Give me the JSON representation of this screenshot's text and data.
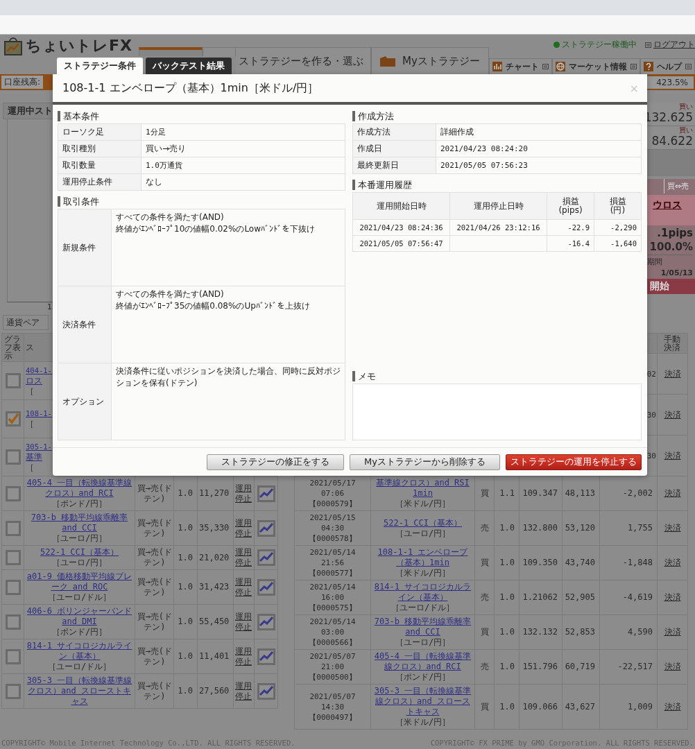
{
  "header": {
    "logo": "ちょいトレFX",
    "nav_tabs": [
      {
        "selected": true
      },
      {
        "label": "ストラテジーを作る・選ぶ",
        "selected": false
      },
      {
        "label": "Myストラテジー",
        "selected": false
      }
    ],
    "status": "ストラテジー稼働中",
    "logout": "ログアウト",
    "tools": [
      {
        "label": "チャート",
        "kind": "chart"
      },
      {
        "label": "マーケット情報",
        "kind": "globe"
      },
      {
        "label": "ヘルプ",
        "kind": "help"
      }
    ],
    "balance_label": "口座残高:",
    "ratio": "423.5%"
  },
  "left_panel": {
    "title": "運用中スト",
    "axis_label": "1",
    "currency_label": "通貨ペア"
  },
  "side_panel": {
    "rates": [
      {
        "label": "買い",
        "value": "132.625"
      },
      {
        "label": "買い",
        "value": "84.622"
      }
    ],
    "card": {
      "header": "買⇔売",
      "link": "ウロス",
      "pips": ".1pips",
      "ratio": "100.0%",
      "period_label": "期間",
      "period": "1/05/13",
      "button": "開始"
    }
  },
  "left_table": {
    "columns": [
      "グラフ表示",
      "ス"
    ],
    "rows": [
      {
        "kind": "partial",
        "checked": false,
        "fragments": [
          "404-1-",
          "ロス",
          "［"
        ]
      },
      {
        "kind": "partial",
        "checked": true,
        "fragments": [
          "108-1-",
          "［"
        ]
      },
      {
        "kind": "partial",
        "checked": false,
        "fragments": [
          "305-1-",
          "基準",
          "［"
        ]
      },
      {
        "kind": "full",
        "checked": false,
        "name": "405-4 一目（転換線基準線クロス）and RCI",
        "pair": "［ポンド/円］",
        "type": "買→売(ドテン)",
        "qty": "1.0",
        "amount": "11,270",
        "stop": "運用停止"
      },
      {
        "kind": "full",
        "checked": false,
        "name": "703-b 移動平均線乖離率 and CCI",
        "pair": "［ユーロ/円］",
        "type": "買→売(ドテン)",
        "qty": "1.0",
        "amount": "35,330",
        "stop": "運用停止"
      },
      {
        "kind": "full",
        "checked": false,
        "name": "522-1 CCI（基本）",
        "pair": "［ユーロ/円］",
        "type": "買→売(ドテン)",
        "qty": "1.0",
        "amount": "21,020",
        "stop": "運用停止"
      },
      {
        "kind": "full",
        "checked": false,
        "name": "a01-9 価格移動平均線ブレーク and ROC",
        "pair": "［ユーロ/ドル］",
        "type": "買→売(ドテン)",
        "qty": "1.0",
        "amount": "31,423",
        "stop": "運用停止"
      },
      {
        "kind": "full",
        "checked": false,
        "name": "406-6 ボリンジャーバンド and DMI",
        "pair": "［ポンド/円］",
        "type": "買→売(ドテン)",
        "qty": "1.0",
        "amount": "55,450",
        "stop": "運用停止"
      },
      {
        "kind": "full",
        "checked": false,
        "name": "814-1 サイコロジカルライン（基本）",
        "pair": "［ユーロ/ドル］",
        "type": "買→売(ドテン)",
        "qty": "1.0",
        "amount": "11,401",
        "stop": "運用停止"
      },
      {
        "kind": "full",
        "checked": false,
        "name": "305-3 一目（転換線基準線クロス）and スローストキャス",
        "type": "買→売(ドテン)",
        "qty": "1.0",
        "amount": "27,560",
        "stop": "運用停止"
      }
    ]
  },
  "right_table": {
    "columns": [
      "手動決済"
    ],
    "rows": [
      {
        "kind": "partial",
        "pnl": "02",
        "settle": "決済"
      },
      {
        "kind": "partial",
        "pnl": "30",
        "settle": "決済"
      },
      {
        "kind": "partial",
        "pnl": "30",
        "settle": "決済"
      },
      {
        "kind": "full",
        "date": "2021/05/17 07:06",
        "id": "【0000579】",
        "name": "基準線クロス）and RSI 1min",
        "pair": "［米ドル/円］",
        "side": "買",
        "qty": "1.1",
        "price": "109.347",
        "amount": "48,113",
        "pnl": "-2,002",
        "settle": "決済"
      },
      {
        "kind": "full",
        "date": "2021/05/15 04:30",
        "id": "【0000578】",
        "name": "522-1 CCI（基本）",
        "pair": "［ユーロ/円］",
        "side": "売",
        "qty": "1.0",
        "price": "132.800",
        "amount": "53,120",
        "pnl": "1,755",
        "settle": "決済"
      },
      {
        "kind": "full",
        "date": "2021/05/14 21:56",
        "id": "【0000577】",
        "name": "108-1-1 エンベロープ（基本）1min",
        "pair": "［米ドル/円］",
        "side": "買",
        "qty": "1.0",
        "price": "109.350",
        "amount": "43,740",
        "pnl": "-1,848",
        "settle": "決済"
      },
      {
        "kind": "full",
        "date": "2021/05/14 16:00",
        "id": "【0000575】",
        "name": "814-1 サイコロジカルライン（基本）",
        "pair": "［ユーロ/ドル］",
        "side": "売",
        "qty": "1.0",
        "price": "1.21062",
        "amount": "52,905",
        "pnl": "-4,619",
        "settle": "決済"
      },
      {
        "kind": "full",
        "date": "2021/05/14 03:00",
        "id": "【0000566】",
        "name": "703-b 移動平均線乖離率 and CCI",
        "pair": "［ユーロ/円］",
        "side": "買",
        "qty": "1.0",
        "price": "132.132",
        "amount": "52,853",
        "pnl": "4,590",
        "settle": "決済"
      },
      {
        "kind": "full",
        "date": "2021/05/07 21:00",
        "id": "【0000500】",
        "name": "405-4 一目（転換線基準線クロス）and RCI",
        "pair": "［ポンド/円］",
        "side": "売",
        "qty": "1.0",
        "price": "151.796",
        "amount": "60,719",
        "pnl": "-22,517",
        "settle": "決済"
      },
      {
        "kind": "full",
        "date": "2021/05/07 14:30",
        "id": "【0000497】",
        "name": "305-3 一目（転換線基準線クロス）and スローストキャス",
        "pair": "［米ドル/円］",
        "side": "買",
        "qty": "1.0",
        "price": "109.066",
        "amount": "43,627",
        "pnl": "1,009",
        "settle": "決済"
      }
    ]
  },
  "footer": {
    "left": "COPYRIGHT© Mobile Internet Technology Co.,LTD. ALL RIGHTS RESERVED.",
    "right": "COPYRIGHT© FX PRIME by GMO Corporation. ALL RIGHTS RESERVED."
  },
  "modal": {
    "tabs": [
      {
        "label": "ストラテジー条件",
        "selected": true
      },
      {
        "label": "バックテスト結果",
        "selected": false
      }
    ],
    "title": "108-1-1 エンベロープ（基本）1min［米ドル/円］",
    "close": "×",
    "basic": {
      "heading": "基本条件",
      "rows": [
        [
          "ローソク足",
          "1分足"
        ],
        [
          "取引種別",
          "買い→売り"
        ],
        [
          "取引数量",
          "1.0万通貨"
        ],
        [
          "運用停止条件",
          "なし"
        ]
      ]
    },
    "trade": {
      "heading": "取引条件",
      "rows": [
        {
          "label": "新規条件",
          "lines": [
            "すべての条件を満たす(AND)",
            "終値がｴﾝﾍﾞﾛｰﾌﾟ10の値幅0.02%のLowﾊﾞﾝﾄﾞを下抜け"
          ]
        },
        {
          "label": "決済条件",
          "lines": [
            "すべての条件を満たす(AND)",
            "終値がｴﾝﾍﾞﾛｰﾌﾟ35の値幅0.08%のUpﾊﾞﾝﾄﾞを上抜け"
          ]
        },
        {
          "label": "オプション",
          "lines": [
            "決済条件に従いポジションを決済した場合、同時に反対ポジションを保有(ドテン)"
          ]
        }
      ]
    },
    "creation": {
      "heading": "作成方法",
      "rows": [
        [
          "作成方法",
          "詳細作成"
        ],
        [
          "作成日",
          "2021/04/23 08:24:20"
        ],
        [
          "最終更新日",
          "2021/05/05 07:56:23"
        ]
      ]
    },
    "history": {
      "heading": "本番運用履歴",
      "columns": [
        "運用開始日時",
        "運用停止日時",
        "損益\n(pips)",
        "損益\n(円)"
      ],
      "rows": [
        [
          "2021/04/23 08:24:36",
          "2021/04/26 23:12:16",
          "-22.9",
          "-2,290"
        ],
        [
          "2021/05/05 07:56:47",
          "",
          "-16.4",
          "-1,640"
        ]
      ]
    },
    "memo": {
      "heading": "メモ"
    },
    "buttons": [
      {
        "label": "ストラテジーの修正をする",
        "kind": "normal"
      },
      {
        "label": "Myストラテジーから削除する",
        "kind": "normal"
      },
      {
        "label": "ストラテジーの運用を停止する",
        "kind": "danger"
      }
    ]
  }
}
